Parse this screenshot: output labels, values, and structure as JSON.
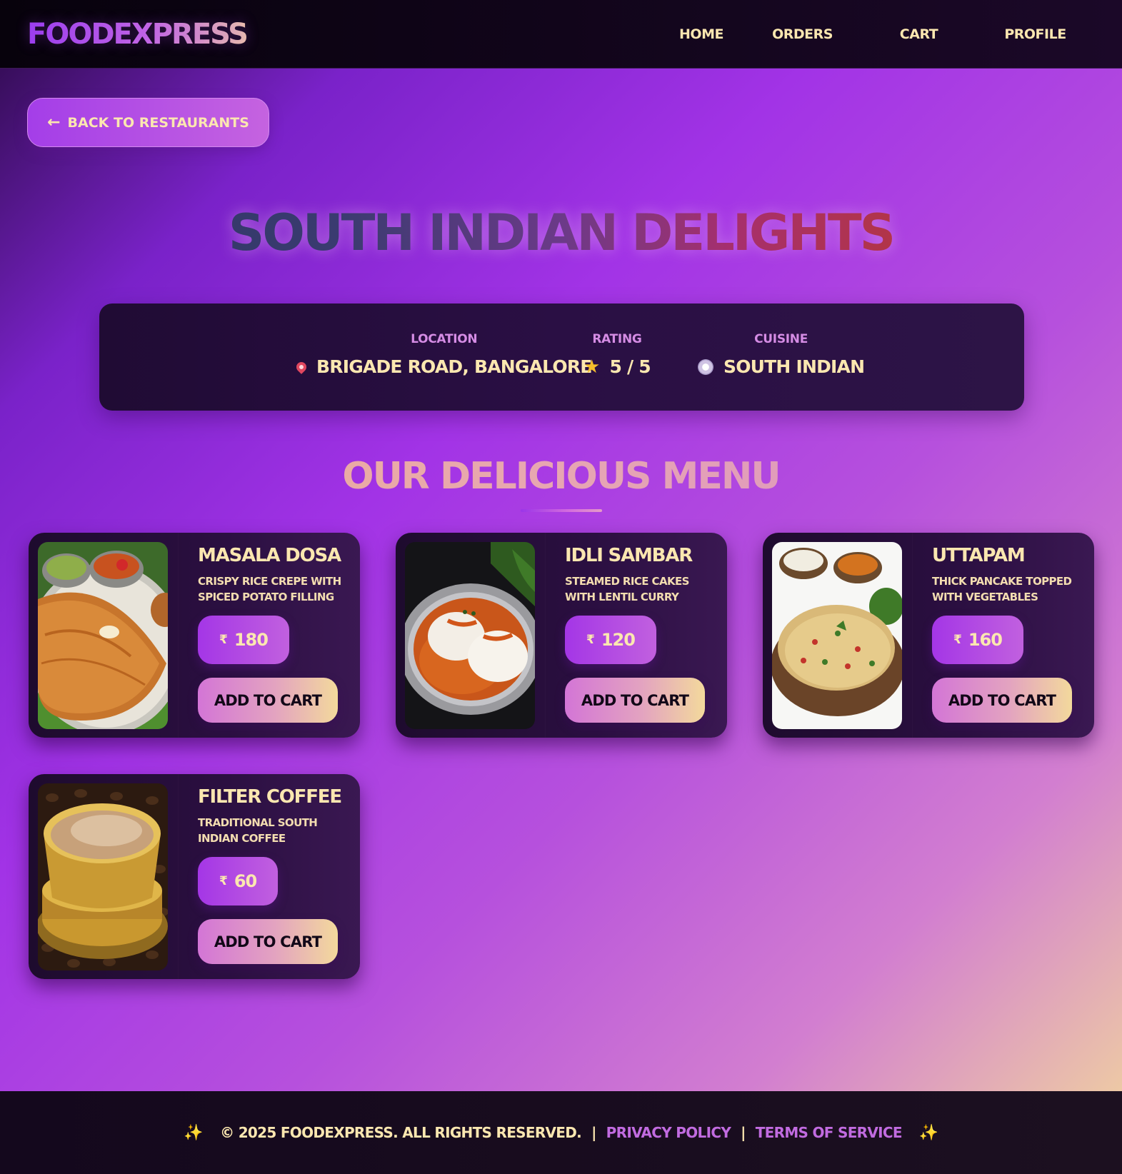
{
  "header": {
    "logo": "FOODEXPRESS",
    "nav": [
      {
        "label": "HOME"
      },
      {
        "label": "ORDERS"
      },
      {
        "label": "CART"
      },
      {
        "label": "PROFILE"
      }
    ]
  },
  "back_button": {
    "arrow": "←",
    "label": "BACK TO RESTAURANTS"
  },
  "restaurant": {
    "name": "SOUTH INDIAN DELIGHTS",
    "location": {
      "label": "LOCATION",
      "icon": "pin-icon",
      "value": "BRIGADE ROAD, BANGALORE"
    },
    "rating": {
      "label": "RATING",
      "icon": "star-icon",
      "symbol": "★",
      "value": "5 / 5"
    },
    "cuisine": {
      "label": "CUISINE",
      "icon": "plate-icon",
      "value": "SOUTH INDIAN"
    }
  },
  "menu": {
    "heading": "OUR DELICIOUS MENU",
    "currency": "₹",
    "add_label": "ADD TO CART",
    "items": [
      {
        "name": "MASALA DOSA",
        "description": "CRISPY RICE CREPE WITH SPICED POTATO FILLING",
        "price": "180"
      },
      {
        "name": "IDLI SAMBAR",
        "description": "STEAMED RICE CAKES WITH LENTIL CURRY",
        "price": "120"
      },
      {
        "name": "UTTAPAM",
        "description": "THICK PANCAKE TOPPED WITH VEGETABLES",
        "price": "160"
      },
      {
        "name": "FILTER COFFEE",
        "description": "TRADITIONAL SOUTH INDIAN COFFEE",
        "price": "60"
      }
    ]
  },
  "footer": {
    "sparkle": "✨",
    "copyright": "© 2025 FOODEXPRESS. ALL RIGHTS RESERVED.",
    "separator": "|",
    "privacy": "PRIVACY POLICY",
    "terms": "TERMS OF SERVICE"
  },
  "colors": {
    "accent": "#a436e6",
    "text_cream": "#fbe7b0",
    "card_bg": "#2b0f41",
    "link": "#c16be0"
  }
}
